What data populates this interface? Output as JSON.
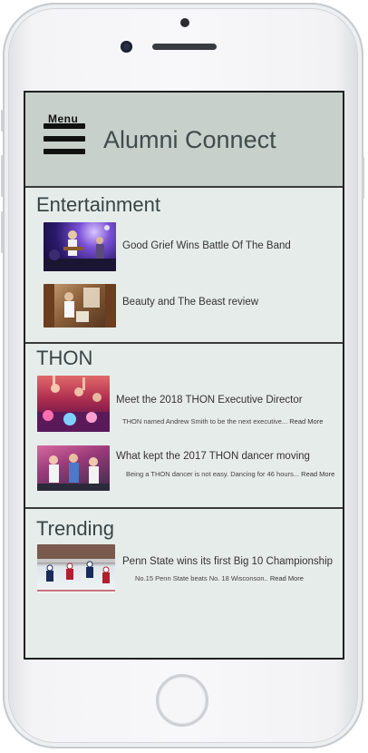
{
  "device": {
    "home_button": "home-button",
    "accent": "#c8d0cb",
    "screen_bg": "#e6ece9"
  },
  "header": {
    "menu_label": "Menu",
    "title": "Alumni Connect"
  },
  "sections": [
    {
      "title": "Entertainment",
      "items": [
        {
          "title": "Good  Grief Wins Battle Of The Band",
          "thumb": "concert-photo"
        },
        {
          "title": "Beauty and The Beast review",
          "thumb": "theater-photo"
        }
      ]
    },
    {
      "title": "THON",
      "items": [
        {
          "title": "Meet the 2018 THON Executive Director",
          "desc": "THON named Andrew Smith to be the next executive...",
          "read_more": "Read More",
          "thumb": "thon-crowd-photo"
        },
        {
          "title": "What kept the 2017 THON dancer moving",
          "desc": "Being a THON dancer is not easy. Dancing for 46 hours...",
          "read_more": "Read More",
          "thumb": "thon-dancers-photo"
        }
      ]
    },
    {
      "title": "Trending",
      "items": [
        {
          "title": "Penn State wins its first Big 10 Championship",
          "desc": "No.15 Penn State beats No. 18 Wisconson..",
          "read_more": "Read More",
          "thumb": "hockey-photo"
        }
      ]
    }
  ]
}
